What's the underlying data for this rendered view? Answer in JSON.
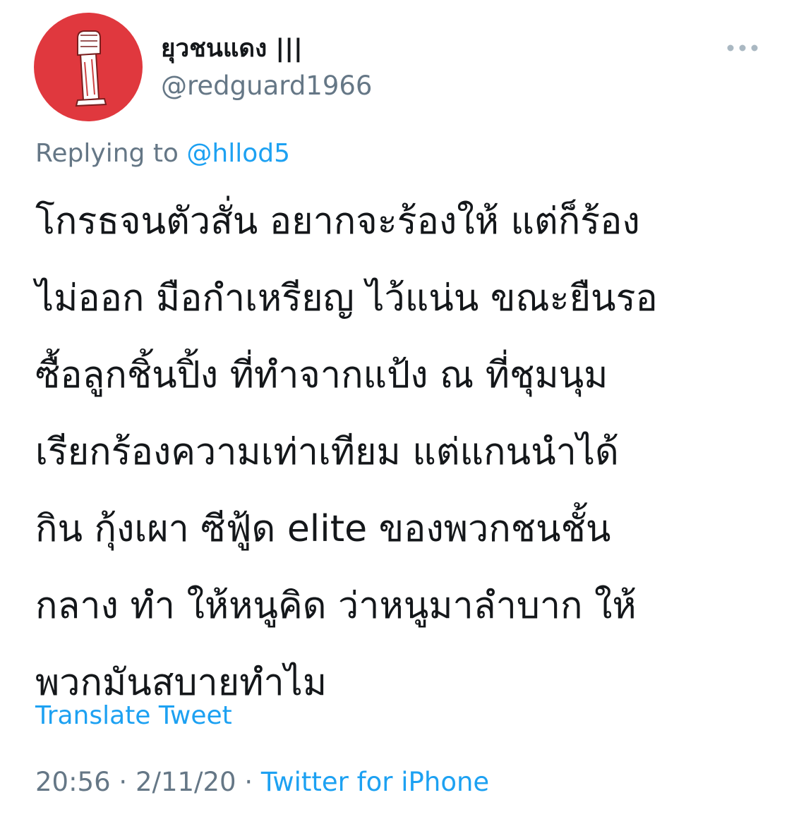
{
  "author": {
    "display_name": "ยุวชนแดง |||",
    "handle": "@redguard1966",
    "avatar_icon": "raised-fist-icon",
    "avatar_color": "#e0383e"
  },
  "more_icon": "more-horizontal-icon",
  "reply": {
    "prefix": "Replying to",
    "handle": "@hllod5"
  },
  "tweet": {
    "lines": [
      "โกรธจนตัวสั่น อยากจะร้องให้ แต่ก็ร้อง",
      "ไม่ออก มือกำเหรียญ ไว้แน่น ขณะยืนรอ",
      "ซื้อลูกชิ้นปิ้ง ที่ทำจากแป้ง ณ ที่ชุมนุม",
      "เรียกร้องความเท่าเทียม แต่แกนนำได้",
      "กิน กุ้งเผา ซีฟู้ด elite ของพวกชนชั้น",
      "กลาง ทำ ให้หนูคิด ว่าหนูมาลำบาก ให้",
      "พวกมันสบายทำไม"
    ]
  },
  "translate_label": "Translate Tweet",
  "meta": {
    "time": "20:56",
    "date": "2/11/20",
    "separator": "·",
    "source": "Twitter for iPhone"
  },
  "colors": {
    "link": "#1da1f2",
    "secondary_text": "#657786",
    "primary_text": "#14171a"
  }
}
